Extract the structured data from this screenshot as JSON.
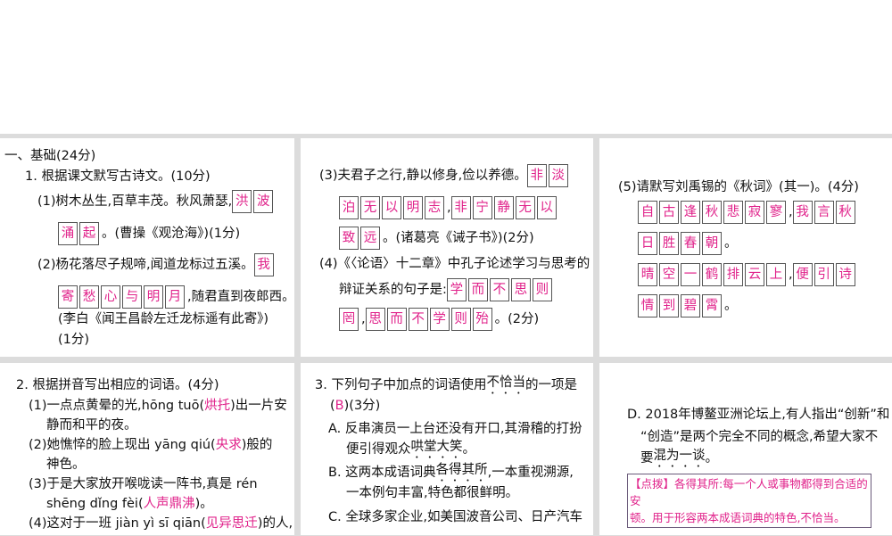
{
  "panels": [
    {
      "name": "panel-basics-q1",
      "lines": [
        [
          {
            "t": "一、基础(24分)"
          }
        ],
        [
          {
            "t": "1. 根据课文默写古诗文。(10分)"
          }
        ],
        [
          {
            "t": "(1)树木丛生,百草丰茂。秋风萧瑟,"
          },
          {
            "b": "洪波"
          }
        ],
        [
          {
            "b": "涌起"
          },
          {
            "t": "。(曹操《观沧海》)(1分)"
          }
        ],
        [
          {
            "t": "(2)杨花落尽子规啼,闻道龙标过五溪。"
          },
          {
            "b": "我"
          }
        ],
        [
          {
            "b": "寄愁心与明月"
          },
          {
            "t": ",随君直到夜郎西。"
          }
        ],
        [
          {
            "t": "(李白《闻王昌龄左迁龙标遥有此寄》)"
          }
        ],
        [
          {
            "t": "(1分)"
          }
        ]
      ]
    },
    {
      "name": "panel-q1-part3-4",
      "lines": [
        [
          {
            "t": "(3)夫君子之行,静以修身,俭以养德。"
          },
          {
            "b": "非淡"
          }
        ],
        [
          {
            "b": "泊无以明志"
          },
          {
            "t": ","
          },
          {
            "b": "非宁静无以"
          }
        ],
        [
          {
            "b": "致远"
          },
          {
            "t": "。(诸葛亮《诫子书》)(2分)"
          }
        ],
        [
          {
            "t": "(4)《〈论语〉十二章》中孔子论述学习与思考的"
          }
        ],
        [
          {
            "t": "辩证关系的句子是:"
          },
          {
            "b": "学而不思则"
          }
        ],
        [
          {
            "b": "罔"
          },
          {
            "t": ","
          },
          {
            "b": "思而不学则殆"
          },
          {
            "t": "。(2分)"
          }
        ]
      ]
    },
    {
      "name": "panel-q1-part5",
      "lines": [
        [
          {
            "t": "(5)请默写刘禹锡的《秋词》(其一)。(4分)"
          }
        ],
        [
          {
            "b": "自古逢秋悲寂寥"
          },
          {
            "t": ","
          },
          {
            "b": "我言秋"
          }
        ],
        [
          {
            "b": "日胜春朝"
          },
          {
            "t": "。"
          }
        ],
        [
          {
            "b": "晴空一鹤排云上"
          },
          {
            "t": ","
          },
          {
            "b": "便引诗"
          }
        ],
        [
          {
            "b": "情到碧霄"
          },
          {
            "t": "。"
          }
        ]
      ]
    },
    {
      "name": "panel-q2",
      "lines": [
        [
          {
            "t": "2. 根据拼音写出相应的词语。(4分)"
          }
        ],
        [
          {
            "t": "(1)一点点黄晕的光,hōng tuō("
          },
          {
            "a": "烘托"
          },
          {
            "t": ")出一片安"
          }
        ],
        [
          {
            "t": "静而和平的夜。"
          }
        ],
        [
          {
            "t": "(2)她憔悴的脸上现出 yāng qiú("
          },
          {
            "a": "央求"
          },
          {
            "t": ")般的"
          }
        ],
        [
          {
            "t": "神色。"
          }
        ],
        [
          {
            "t": "(3)于是大家放开喉咙读一阵书,真是 rén"
          }
        ],
        [
          {
            "t": "shēng dǐng fèi("
          },
          {
            "a": "人声鼎沸"
          },
          {
            "t": ")。"
          }
        ],
        [
          {
            "t": "(4)这对于一班 jiàn yì sī qiān("
          },
          {
            "a": "见异思迁"
          },
          {
            "t": ")的人,"
          }
        ]
      ]
    },
    {
      "name": "panel-q3",
      "lines": [
        [
          {
            "t": "3. 下列句子中加点的词语使用"
          },
          {
            "d": "不恰当"
          },
          {
            "t": "的一项是"
          }
        ],
        [
          {
            "t": "(  "
          },
          {
            "a": "B"
          },
          {
            "t": "  )(3分)"
          }
        ],
        [
          {
            "t": "A. 反串演员一上台还没有开口,其滑稽的打扮"
          }
        ],
        [
          {
            "t": "便引得观众"
          },
          {
            "d": "哄堂大笑"
          },
          {
            "t": "。"
          }
        ],
        [
          {
            "t": "B. 这两本成语词典"
          },
          {
            "d": "各得其所"
          },
          {
            "t": ",一本重视溯源,"
          }
        ],
        [
          {
            "t": "一本例句丰富,特色都很鲜明。"
          }
        ],
        [
          {
            "t": "C. 全球多家企业,如美国波音公司、日产汽车"
          }
        ]
      ]
    },
    {
      "name": "panel-q3-option-d",
      "lines": [
        [
          {
            "t": "D. 2018年博鳌亚洲论坛上,有人指出“创新”和"
          }
        ],
        [
          {
            "t": "“创造”是两个完全不同的概念,希望大家不"
          }
        ],
        [
          {
            "t": "要"
          },
          {
            "d": "混为一谈"
          },
          {
            "t": "。"
          }
        ]
      ]
    }
  ],
  "note": {
    "line1": "【点拨】各得其所:每一个人或事物都得到合适的安",
    "line2": "顿。用于形容两本成语词典的特色,不恰当。"
  }
}
